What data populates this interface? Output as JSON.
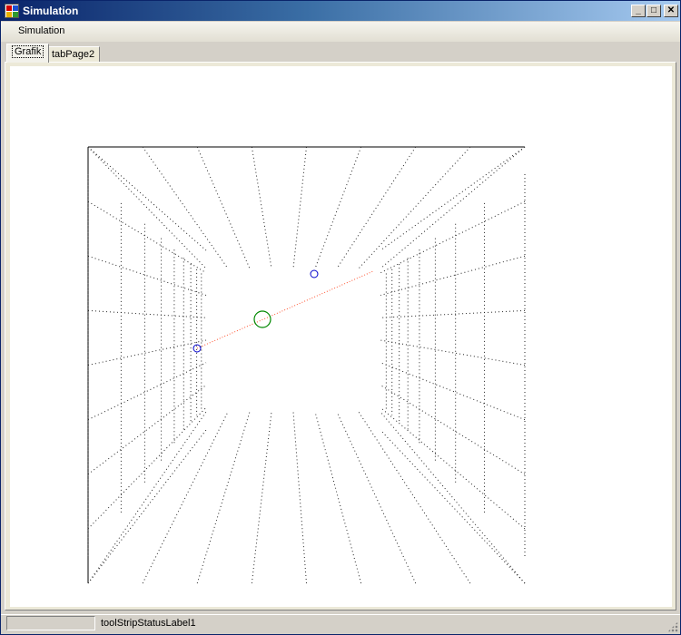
{
  "window": {
    "title": "Simulation"
  },
  "menu": {
    "items": [
      "Simulation"
    ]
  },
  "tabs": [
    {
      "label": "Grafik",
      "active": true
    },
    {
      "label": "tabPage2",
      "active": false
    }
  ],
  "status": {
    "label": "toolStripStatusLabel1"
  },
  "colors": {
    "grid": "#222222",
    "trajectory": "#ff5533",
    "particle": "#0000cc",
    "target": "#008800"
  },
  "caption_buttons": [
    "minimize-icon",
    "maximize-icon",
    "close-icon"
  ]
}
